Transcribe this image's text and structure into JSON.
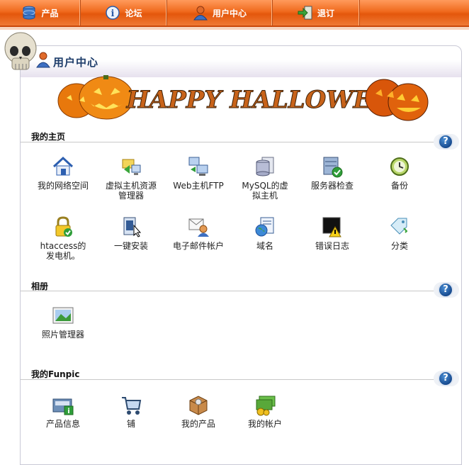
{
  "nav": {
    "items": [
      {
        "label": "产品",
        "icon": "database-icon"
      },
      {
        "label": "论坛",
        "icon": "info-icon"
      },
      {
        "label": "用户中心",
        "icon": "user-icon"
      },
      {
        "label": "退订",
        "icon": "exit-door-icon"
      }
    ]
  },
  "panel": {
    "title": "用户中心",
    "banner_text": "HAPPY HALLOWEEN"
  },
  "sections": [
    {
      "title": "我的主页",
      "items": [
        {
          "label": "我的网络空间",
          "icon": "home-icon"
        },
        {
          "label": "虚拟主机资源管理器",
          "icon": "folder-network-icon"
        },
        {
          "label": "Web主机FTP",
          "icon": "ftp-computers-icon"
        },
        {
          "label": "MySQL的虚拟主机",
          "icon": "mysql-database-icon"
        },
        {
          "label": "服务器检查",
          "icon": "server-check-icon"
        },
        {
          "label": "备份",
          "icon": "backup-clock-icon"
        },
        {
          "label": "htaccess的发电机。",
          "icon": "lock-check-icon"
        },
        {
          "label": "一键安装",
          "icon": "one-click-install-icon"
        },
        {
          "label": "电子邮件帐户",
          "icon": "email-account-icon"
        },
        {
          "label": "域名",
          "icon": "domain-globe-icon"
        },
        {
          "label": "错误日志",
          "icon": "error-log-icon"
        },
        {
          "label": "分类",
          "icon": "tag-icon"
        }
      ]
    },
    {
      "title": "相册",
      "items": [
        {
          "label": "照片管理器",
          "icon": "photo-icon"
        }
      ]
    },
    {
      "title": "我的Funpic",
      "items": [
        {
          "label": "产品信息",
          "icon": "product-info-icon"
        },
        {
          "label": "铺",
          "icon": "shop-cart-icon"
        },
        {
          "label": "我的产品",
          "icon": "product-box-icon"
        },
        {
          "label": "我的帐户",
          "icon": "money-account-icon"
        }
      ]
    }
  ],
  "help_label": "?",
  "colors": {
    "nav_orange": "#e4570c",
    "title_blue": "#1d3c6a",
    "help_blue": "#174a8e"
  }
}
